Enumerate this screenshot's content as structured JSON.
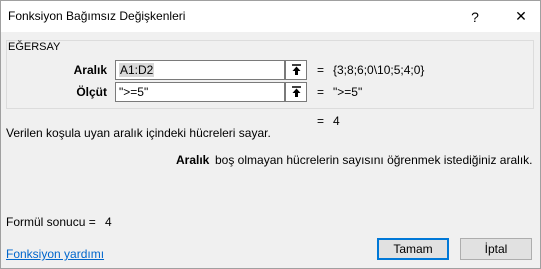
{
  "window": {
    "title": "Fonksiyon Bağımsız Değişkenleri",
    "help_glyph": "?",
    "close_glyph": "✕"
  },
  "function": {
    "name": "EĞERSAY"
  },
  "arguments": [
    {
      "label": "Aralık",
      "input": "A1:D2",
      "equals": "=",
      "value": "{3;8;6;0\\10;5;4;0}"
    },
    {
      "label": "Ölçüt",
      "input": "\">=5\"",
      "equals": "=",
      "value": "\">=5\""
    }
  ],
  "result": {
    "equals": "=",
    "value": "4"
  },
  "description": "Verilen koşula uyan aralık içindeki hücreleri sayar.",
  "argument_help": {
    "name": "Aralık",
    "text": "boş olmayan hücrelerin sayısını öğrenmek istediğiniz aralık."
  },
  "formula_result": {
    "label": "Formül sonucu =",
    "value": "4"
  },
  "help_link": "Fonksiyon yardımı",
  "buttons": {
    "ok": "Tamam",
    "cancel": "İptal"
  },
  "icons": {
    "ref_button": "collapse-dialog-arrow-icon"
  },
  "colors": {
    "link": "#0066cc",
    "ok_border": "#0078d7"
  }
}
